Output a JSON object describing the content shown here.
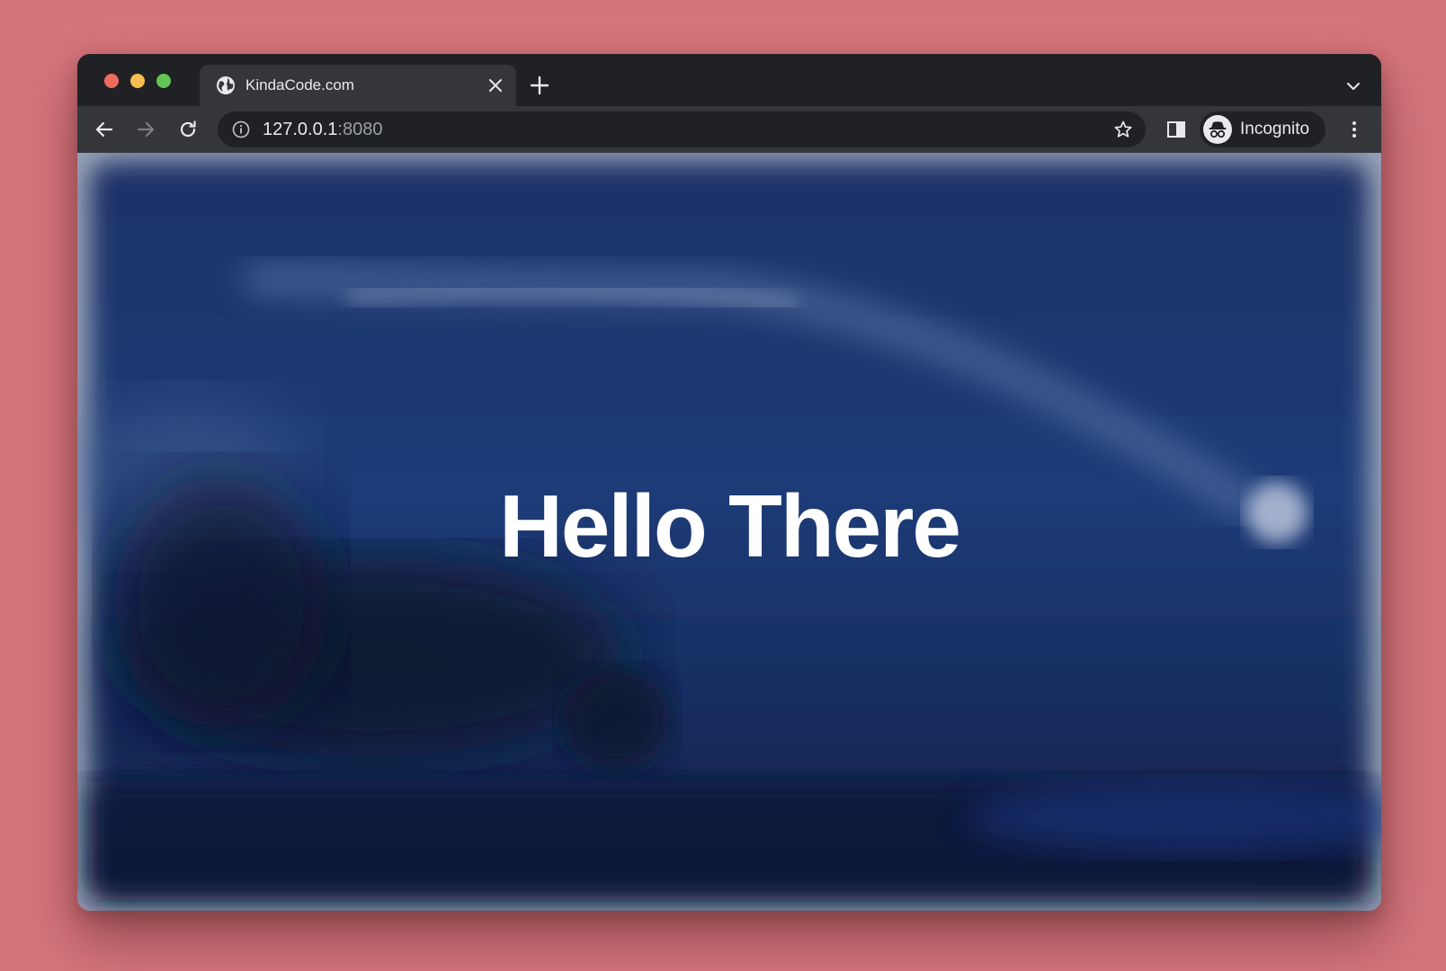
{
  "browser": {
    "tab": {
      "title": "KindaCode.com",
      "favicon": "globe-icon"
    },
    "omnibox": {
      "url_host": "127.0.0.1",
      "url_port": ":8080"
    },
    "profile": {
      "label": "Incognito",
      "icon": "incognito-icon"
    }
  },
  "page": {
    "headline": "Hello There"
  },
  "colors": {
    "backdrop": "#d5747b",
    "chrome_dark": "#202124",
    "chrome_toolbar": "#35363a",
    "night_sky": "#1a3468",
    "headline_text": "#ffffff"
  }
}
